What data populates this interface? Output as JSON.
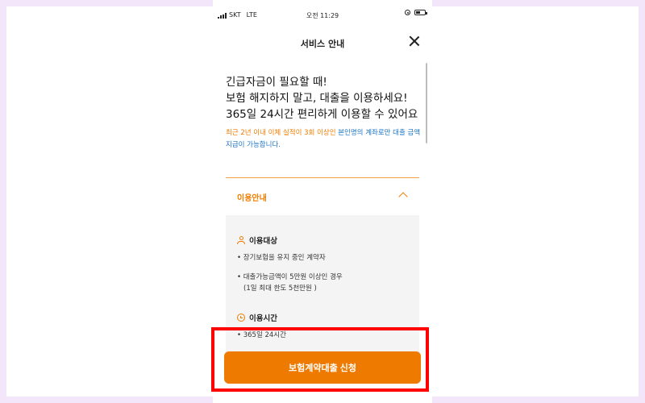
{
  "status_bar": {
    "carrier": "SKT",
    "network": "LTE",
    "time": "오전 11:29"
  },
  "header": {
    "title": "서비스 안내"
  },
  "headline": {
    "line1": "긴급자금이 필요할 때!",
    "line2": "보험 해지하지 말고, 대출을 이용하세요!",
    "line3": "365일 24시간 편리하게 이용할 수 있어요"
  },
  "notice": {
    "part1": "최근 2년 이내 이체 실적이 3회 이상인 ",
    "part2": "본인명의 계좌로만 대출 금액 지급이 가능합니다."
  },
  "accordion": {
    "label": "이용안내",
    "section1": {
      "title": "이용대상",
      "items": [
        "• 장기보험을 유지 중인 계약자",
        "• 대출가능금액이 5만원 이상인 경우",
        "(1일 최대 한도 5천만원 )"
      ]
    },
    "section2": {
      "title": "이용시간",
      "items": [
        "• 365일 24시간"
      ]
    }
  },
  "cta": {
    "label": "보험계약대출 신청"
  },
  "colors": {
    "accent": "#ee7a00",
    "link": "#1a74c4",
    "highlight": "#ff0000"
  }
}
